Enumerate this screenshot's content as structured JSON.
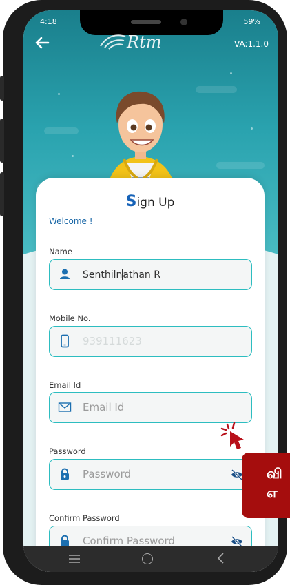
{
  "status": {
    "time": "4:18",
    "battery": "59%"
  },
  "header": {
    "logo_text": "Rtm",
    "version": "VA:1.1.0"
  },
  "card": {
    "title_first": "S",
    "title_rest": "ign Up",
    "welcome": "Welcome !"
  },
  "fields": {
    "name": {
      "label": "Name",
      "value_before_caret": "Senthiln",
      "value_after_caret": "athan R"
    },
    "mobile": {
      "label": "Mobile No.",
      "value": "939111623"
    },
    "email": {
      "label": "Email Id",
      "placeholder": "Email Id"
    },
    "password": {
      "label": "Password",
      "placeholder": "Password"
    },
    "confirm_password": {
      "label": "Confirm Password",
      "placeholder": "Confirm Password"
    }
  },
  "banner": {
    "line1": "வி",
    "line2": "எ"
  },
  "colors": {
    "accent": "#2dbdc0",
    "header_teal": "#1a7f8c",
    "title_blue": "#1763b8",
    "banner_red": "#a50d0d"
  },
  "icons": [
    "back-arrow-icon",
    "person-icon",
    "phone-icon",
    "mail-icon",
    "lock-icon",
    "key-lock-icon",
    "eye-off-icon",
    "tap-hint-icon",
    "nav-menu-icon",
    "nav-home-icon",
    "nav-back-icon"
  ]
}
